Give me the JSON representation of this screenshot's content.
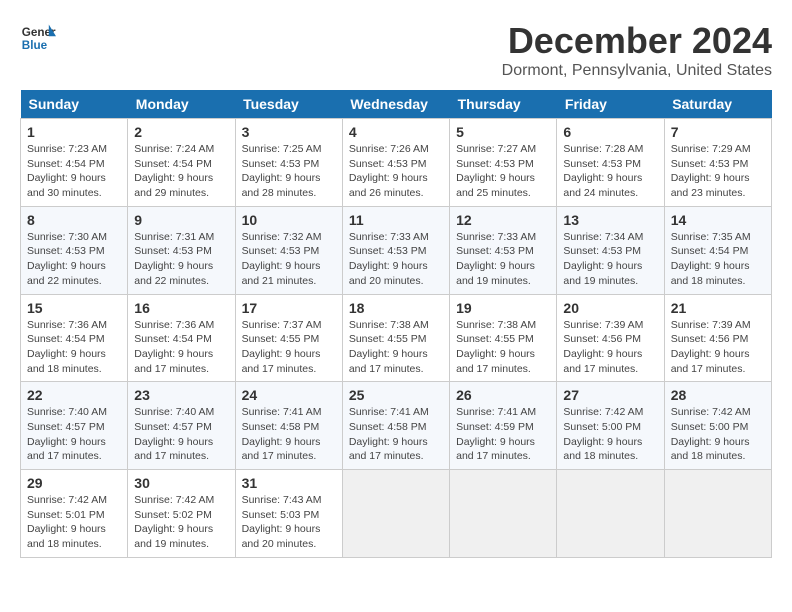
{
  "header": {
    "logo_line1": "General",
    "logo_line2": "Blue",
    "month": "December 2024",
    "location": "Dormont, Pennsylvania, United States"
  },
  "weekdays": [
    "Sunday",
    "Monday",
    "Tuesday",
    "Wednesday",
    "Thursday",
    "Friday",
    "Saturday"
  ],
  "weeks": [
    [
      {
        "day": "1",
        "info": "Sunrise: 7:23 AM\nSunset: 4:54 PM\nDaylight: 9 hours\nand 30 minutes."
      },
      {
        "day": "2",
        "info": "Sunrise: 7:24 AM\nSunset: 4:54 PM\nDaylight: 9 hours\nand 29 minutes."
      },
      {
        "day": "3",
        "info": "Sunrise: 7:25 AM\nSunset: 4:53 PM\nDaylight: 9 hours\nand 28 minutes."
      },
      {
        "day": "4",
        "info": "Sunrise: 7:26 AM\nSunset: 4:53 PM\nDaylight: 9 hours\nand 26 minutes."
      },
      {
        "day": "5",
        "info": "Sunrise: 7:27 AM\nSunset: 4:53 PM\nDaylight: 9 hours\nand 25 minutes."
      },
      {
        "day": "6",
        "info": "Sunrise: 7:28 AM\nSunset: 4:53 PM\nDaylight: 9 hours\nand 24 minutes."
      },
      {
        "day": "7",
        "info": "Sunrise: 7:29 AM\nSunset: 4:53 PM\nDaylight: 9 hours\nand 23 minutes."
      }
    ],
    [
      {
        "day": "8",
        "info": "Sunrise: 7:30 AM\nSunset: 4:53 PM\nDaylight: 9 hours\nand 22 minutes."
      },
      {
        "day": "9",
        "info": "Sunrise: 7:31 AM\nSunset: 4:53 PM\nDaylight: 9 hours\nand 22 minutes."
      },
      {
        "day": "10",
        "info": "Sunrise: 7:32 AM\nSunset: 4:53 PM\nDaylight: 9 hours\nand 21 minutes."
      },
      {
        "day": "11",
        "info": "Sunrise: 7:33 AM\nSunset: 4:53 PM\nDaylight: 9 hours\nand 20 minutes."
      },
      {
        "day": "12",
        "info": "Sunrise: 7:33 AM\nSunset: 4:53 PM\nDaylight: 9 hours\nand 19 minutes."
      },
      {
        "day": "13",
        "info": "Sunrise: 7:34 AM\nSunset: 4:53 PM\nDaylight: 9 hours\nand 19 minutes."
      },
      {
        "day": "14",
        "info": "Sunrise: 7:35 AM\nSunset: 4:54 PM\nDaylight: 9 hours\nand 18 minutes."
      }
    ],
    [
      {
        "day": "15",
        "info": "Sunrise: 7:36 AM\nSunset: 4:54 PM\nDaylight: 9 hours\nand 18 minutes."
      },
      {
        "day": "16",
        "info": "Sunrise: 7:36 AM\nSunset: 4:54 PM\nDaylight: 9 hours\nand 17 minutes."
      },
      {
        "day": "17",
        "info": "Sunrise: 7:37 AM\nSunset: 4:55 PM\nDaylight: 9 hours\nand 17 minutes."
      },
      {
        "day": "18",
        "info": "Sunrise: 7:38 AM\nSunset: 4:55 PM\nDaylight: 9 hours\nand 17 minutes."
      },
      {
        "day": "19",
        "info": "Sunrise: 7:38 AM\nSunset: 4:55 PM\nDaylight: 9 hours\nand 17 minutes."
      },
      {
        "day": "20",
        "info": "Sunrise: 7:39 AM\nSunset: 4:56 PM\nDaylight: 9 hours\nand 17 minutes."
      },
      {
        "day": "21",
        "info": "Sunrise: 7:39 AM\nSunset: 4:56 PM\nDaylight: 9 hours\nand 17 minutes."
      }
    ],
    [
      {
        "day": "22",
        "info": "Sunrise: 7:40 AM\nSunset: 4:57 PM\nDaylight: 9 hours\nand 17 minutes."
      },
      {
        "day": "23",
        "info": "Sunrise: 7:40 AM\nSunset: 4:57 PM\nDaylight: 9 hours\nand 17 minutes."
      },
      {
        "day": "24",
        "info": "Sunrise: 7:41 AM\nSunset: 4:58 PM\nDaylight: 9 hours\nand 17 minutes."
      },
      {
        "day": "25",
        "info": "Sunrise: 7:41 AM\nSunset: 4:58 PM\nDaylight: 9 hours\nand 17 minutes."
      },
      {
        "day": "26",
        "info": "Sunrise: 7:41 AM\nSunset: 4:59 PM\nDaylight: 9 hours\nand 17 minutes."
      },
      {
        "day": "27",
        "info": "Sunrise: 7:42 AM\nSunset: 5:00 PM\nDaylight: 9 hours\nand 18 minutes."
      },
      {
        "day": "28",
        "info": "Sunrise: 7:42 AM\nSunset: 5:00 PM\nDaylight: 9 hours\nand 18 minutes."
      }
    ],
    [
      {
        "day": "29",
        "info": "Sunrise: 7:42 AM\nSunset: 5:01 PM\nDaylight: 9 hours\nand 18 minutes."
      },
      {
        "day": "30",
        "info": "Sunrise: 7:42 AM\nSunset: 5:02 PM\nDaylight: 9 hours\nand 19 minutes."
      },
      {
        "day": "31",
        "info": "Sunrise: 7:43 AM\nSunset: 5:03 PM\nDaylight: 9 hours\nand 20 minutes."
      },
      {
        "day": "",
        "info": ""
      },
      {
        "day": "",
        "info": ""
      },
      {
        "day": "",
        "info": ""
      },
      {
        "day": "",
        "info": ""
      }
    ]
  ]
}
